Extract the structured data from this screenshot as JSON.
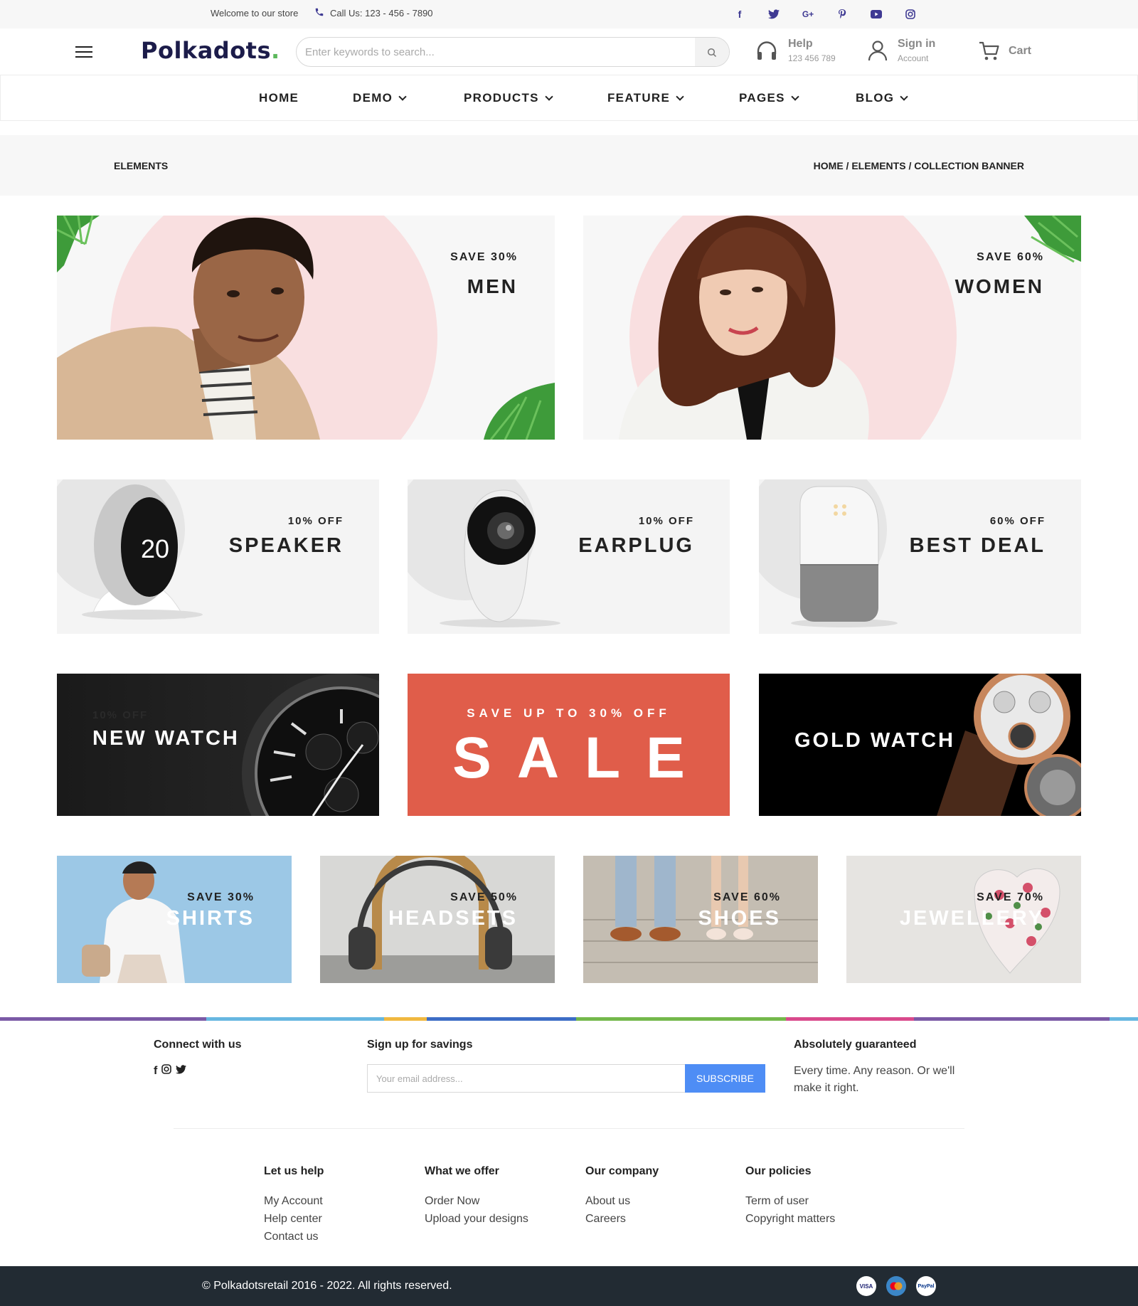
{
  "topbar": {
    "welcome": "Welcome to our store",
    "phone": "Call Us: 123 - 456 - 7890",
    "social_icons": [
      "facebook-icon",
      "twitter-icon",
      "google-plus-icon",
      "pinterest-icon",
      "youtube-icon",
      "instagram-icon"
    ]
  },
  "header": {
    "logo": "Polkadots",
    "logo_dot": ".",
    "search_placeholder": "Enter keywords to search...",
    "help_title": "Help",
    "help_sub": "123 456 789",
    "signin_title": "Sign in",
    "signin_sub": "Account",
    "cart": "Cart"
  },
  "nav": {
    "home": "HOME",
    "demo": "DEMO",
    "products": "PRODUCTS",
    "feature": "FEATURE",
    "pages": "PAGES",
    "blog": "BLOG"
  },
  "breadcrumb": {
    "title": "ELEMENTS",
    "path": "HOME / ELEMENTS / COLLECTION BANNER"
  },
  "banners": {
    "men": {
      "save": "SAVE 30%",
      "title": "MEN"
    },
    "women": {
      "save": "SAVE 60%",
      "title": "WOMEN"
    },
    "speaker": {
      "save": "10% OFF",
      "title": "SPEAKER"
    },
    "earplug": {
      "save": "10% OFF",
      "title": "EARPLUG"
    },
    "best_deal": {
      "save": "60% OFF",
      "title": "BEST DEAL"
    },
    "new_watch": {
      "save": "10% OFF",
      "title": "NEW WATCH"
    },
    "sale": {
      "save": "SAVE UP TO 30% OFF",
      "title": "SALE"
    },
    "gold_watch": {
      "title": "GOLD WATCH"
    },
    "shirts": {
      "save": "SAVE 30%",
      "title": "SHIRTS"
    },
    "headsets": {
      "save": "SAVE 50%",
      "title": "HEADSETS"
    },
    "shoes": {
      "save": "SAVE 60%",
      "title": "SHOES"
    },
    "jewellery": {
      "save": "SAVE 70%",
      "title": "JEWELLERY"
    }
  },
  "colors": {
    "accent": "#3f3a93",
    "sale_bg": "#e05d4a",
    "subscribe": "#4e8df5",
    "footer_bottom": "#222b33"
  },
  "footer": {
    "connect": "Connect with us",
    "signup": "Sign up for savings",
    "email_placeholder": "Your email address...",
    "subscribe": "SUBSCRIBE",
    "guarantee_title": "Absolutely guaranteed",
    "guarantee_text": "Every time. Any reason. Or we'll make it right.",
    "cols": [
      {
        "title": "Let us help",
        "links": [
          "My Account",
          "Help center",
          "Contact us"
        ]
      },
      {
        "title": "What we offer",
        "links": [
          "Order Now",
          "Upload your designs"
        ]
      },
      {
        "title": "Our company",
        "links": [
          "About us",
          "Careers"
        ]
      },
      {
        "title": "Our policies",
        "links": [
          "Term of user",
          "Copyright matters"
        ]
      }
    ],
    "copyright": "© Polkadotsretail 2016 - 2022. All rights reserved.",
    "payments": [
      "VISA",
      "MC",
      "PayPal"
    ]
  }
}
